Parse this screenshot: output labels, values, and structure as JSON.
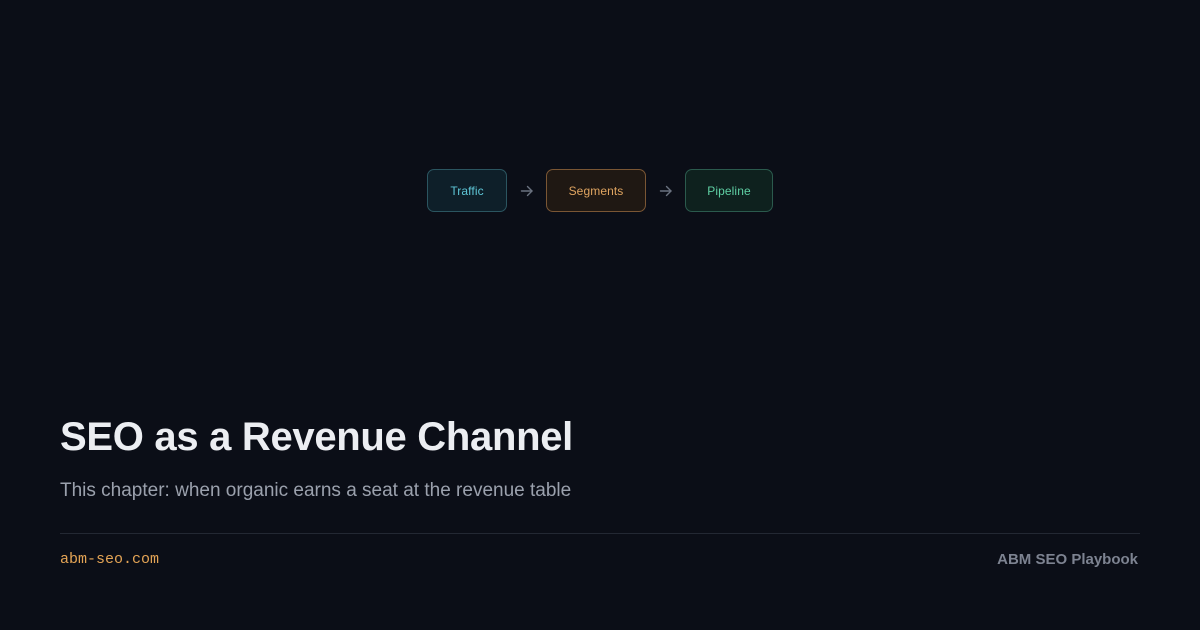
{
  "flow": {
    "nodes": [
      {
        "label": "Traffic",
        "color": "#5ec6d6"
      },
      {
        "label": "Segments",
        "color": "#e0a561"
      },
      {
        "label": "Pipeline",
        "color": "#5fd0a4"
      }
    ],
    "connector_icon": "arrow-right-icon"
  },
  "heading": {
    "title": "SEO as a Revenue Channel",
    "subtitle": "This chapter: when organic earns a seat at the revenue table"
  },
  "footer": {
    "domain": "abm-seo.com",
    "brand": "ABM SEO Playbook"
  },
  "colors": {
    "background": "#0b0e17",
    "accent": "#e4a455"
  }
}
